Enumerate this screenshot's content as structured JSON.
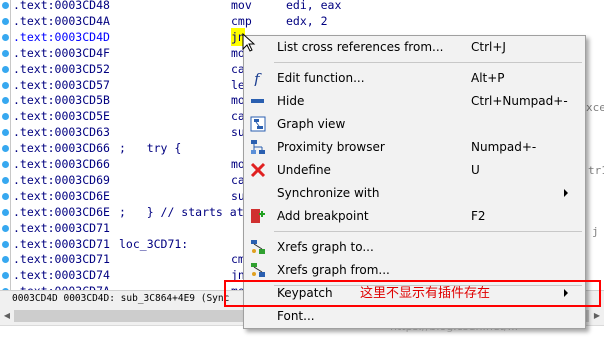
{
  "listing": {
    "lines": [
      {
        "addr": ".text:0003CD48",
        "label": "",
        "mnem": "mov",
        "ops": "edi, eax"
      },
      {
        "addr": ".text:0003CD4A",
        "label": "",
        "mnem": "cmp",
        "ops": "edx, 2"
      },
      {
        "addr": ".text:0003CD4D",
        "label": "",
        "mnem": "jn",
        "ops": ""
      },
      {
        "addr": ".text:0003CD4F",
        "label": "",
        "mnem": "mo",
        "ops": ""
      },
      {
        "addr": ".text:0003CD52",
        "label": "",
        "mnem": "ca",
        "ops": ""
      },
      {
        "addr": ".text:0003CD57",
        "label": "",
        "mnem": "le",
        "ops": ""
      },
      {
        "addr": ".text:0003CD5B",
        "label": "",
        "mnem": "mo",
        "ops": ""
      },
      {
        "addr": ".text:0003CD5E",
        "label": "",
        "mnem": "ca",
        "ops": ""
      },
      {
        "addr": ".text:0003CD63",
        "label": "",
        "mnem": "su",
        "ops": ""
      },
      {
        "addr": ".text:0003CD66",
        "label": ";   try {",
        "mnem": "",
        "ops": ""
      },
      {
        "addr": ".text:0003CD66",
        "label": "",
        "mnem": "mo",
        "ops": ""
      },
      {
        "addr": ".text:0003CD69",
        "label": "",
        "mnem": "ca",
        "ops": ""
      },
      {
        "addr": ".text:0003CD6E",
        "label": "",
        "mnem": "su",
        "ops": ""
      },
      {
        "addr": ".text:0003CD6E",
        "label": ";   } // starts at",
        "mnem": "",
        "ops": ""
      },
      {
        "addr": ".text:0003CD71",
        "label": "",
        "mnem": "",
        "ops": ""
      },
      {
        "addr": ".text:0003CD71",
        "label": "loc_3CD71:",
        "mnem": "",
        "ops": ""
      },
      {
        "addr": ".text:0003CD71",
        "label": "",
        "mnem": "cm",
        "ops": ""
      },
      {
        "addr": ".text:0003CD74",
        "label": "",
        "mnem": "jn",
        "ops": ""
      },
      {
        "addr": ".text:0003CD7A",
        "label": "",
        "mnem": "mo",
        "ops": ""
      }
    ],
    "selected_index": 2,
    "right_fragments": [
      "xcep",
      "tr1",
      "j"
    ]
  },
  "infobar": {
    "text": "0003CD4D 0003CD4D: sub_3C864+4E9 (Sync"
  },
  "menu": {
    "items": [
      {
        "label": "List cross references from...",
        "shortcut": "Ctrl+J",
        "icon": "none",
        "submenu": false
      },
      {
        "label": "Edit function...",
        "shortcut": "Alt+P",
        "icon": "function-icon",
        "submenu": false
      },
      {
        "label": "Hide",
        "shortcut": "Ctrl+Numpad+-",
        "icon": "hide-icon",
        "submenu": false
      },
      {
        "label": "Graph view",
        "shortcut": "",
        "icon": "graph-view-icon",
        "submenu": false
      },
      {
        "label": "Proximity browser",
        "shortcut": "Numpad+-",
        "icon": "proximity-icon",
        "submenu": false
      },
      {
        "label": "Undefine",
        "shortcut": "U",
        "icon": "undefine-icon",
        "submenu": false
      },
      {
        "label": "Synchronize with",
        "shortcut": "",
        "icon": "none",
        "submenu": true
      },
      {
        "label": "Add breakpoint",
        "shortcut": "F2",
        "icon": "breakpoint-icon",
        "submenu": false
      },
      {
        "label": "Xrefs graph to...",
        "shortcut": "",
        "icon": "xrefs-to-icon",
        "submenu": false
      },
      {
        "label": "Xrefs graph from...",
        "shortcut": "",
        "icon": "xrefs-from-icon",
        "submenu": false
      },
      {
        "label": "Keypatch",
        "shortcut": "",
        "icon": "none",
        "submenu": true
      },
      {
        "label": "Font...",
        "shortcut": "",
        "icon": "none",
        "submenu": false
      }
    ]
  },
  "annotation": {
    "text": "这里不显示有插件存在",
    "color": "#ff0000"
  },
  "watermark": "https://blog.csdn.net/..."
}
